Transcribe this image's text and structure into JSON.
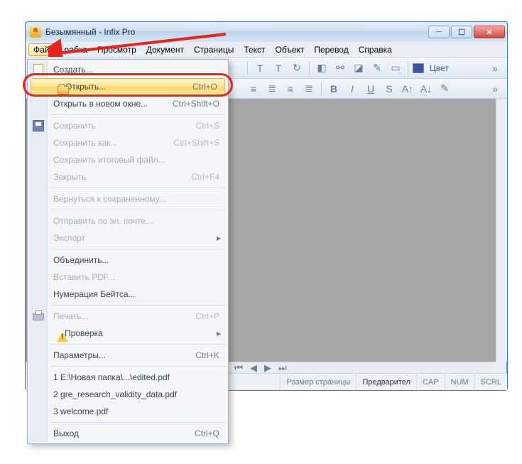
{
  "window": {
    "title": "Безымянный - Infix Pro"
  },
  "menubar": {
    "items": [
      "Файл",
      "рабка",
      "Просмотр",
      "Документ",
      "Страницы",
      "Текст",
      "Объект",
      "Перевод",
      "Справка"
    ],
    "active_index": 0
  },
  "toolbar": {
    "color_label": "Цвет"
  },
  "file_menu": {
    "create": "Создать...",
    "open": "Открыть...",
    "open_sc": "Ctrl+O",
    "open_newwin": "Открыть в новом окне...",
    "open_newwin_sc": "Ctrl+Shift+O",
    "save": "Сохранить",
    "save_sc": "Ctrl+S",
    "save_as": "Сохранить как...",
    "save_as_sc": "Ctrl+Shift+S",
    "save_final": "Сохранить итоговый файл...",
    "close": "Закрыть",
    "close_sc": "Ctrl+F4",
    "revert": "Вернуться к сохраненному...",
    "send_email": "Отправить по эл. почте...",
    "export": "Экспорт",
    "merge": "Объединить...",
    "insert_pdf": "Вставить PDF...",
    "bates": "Нумерация Бейтса...",
    "print": "Печать...",
    "print_sc": "Ctrl+P",
    "check": "Проверка",
    "prefs": "Параметры...",
    "prefs_sc": "Ctrl+K",
    "recent": [
      "1 E:\\Новая папка\\...\\edited.pdf",
      "2 gre_research_validity_data.pdf",
      "3 welcome.pdf"
    ],
    "exit": "Выход",
    "exit_sc": "Ctrl+Q"
  },
  "statusbar": {
    "page_size": "Размер страницы",
    "preview": "Предварител",
    "cap": "CAP",
    "num": "NUM",
    "scrl": "SCRL"
  }
}
